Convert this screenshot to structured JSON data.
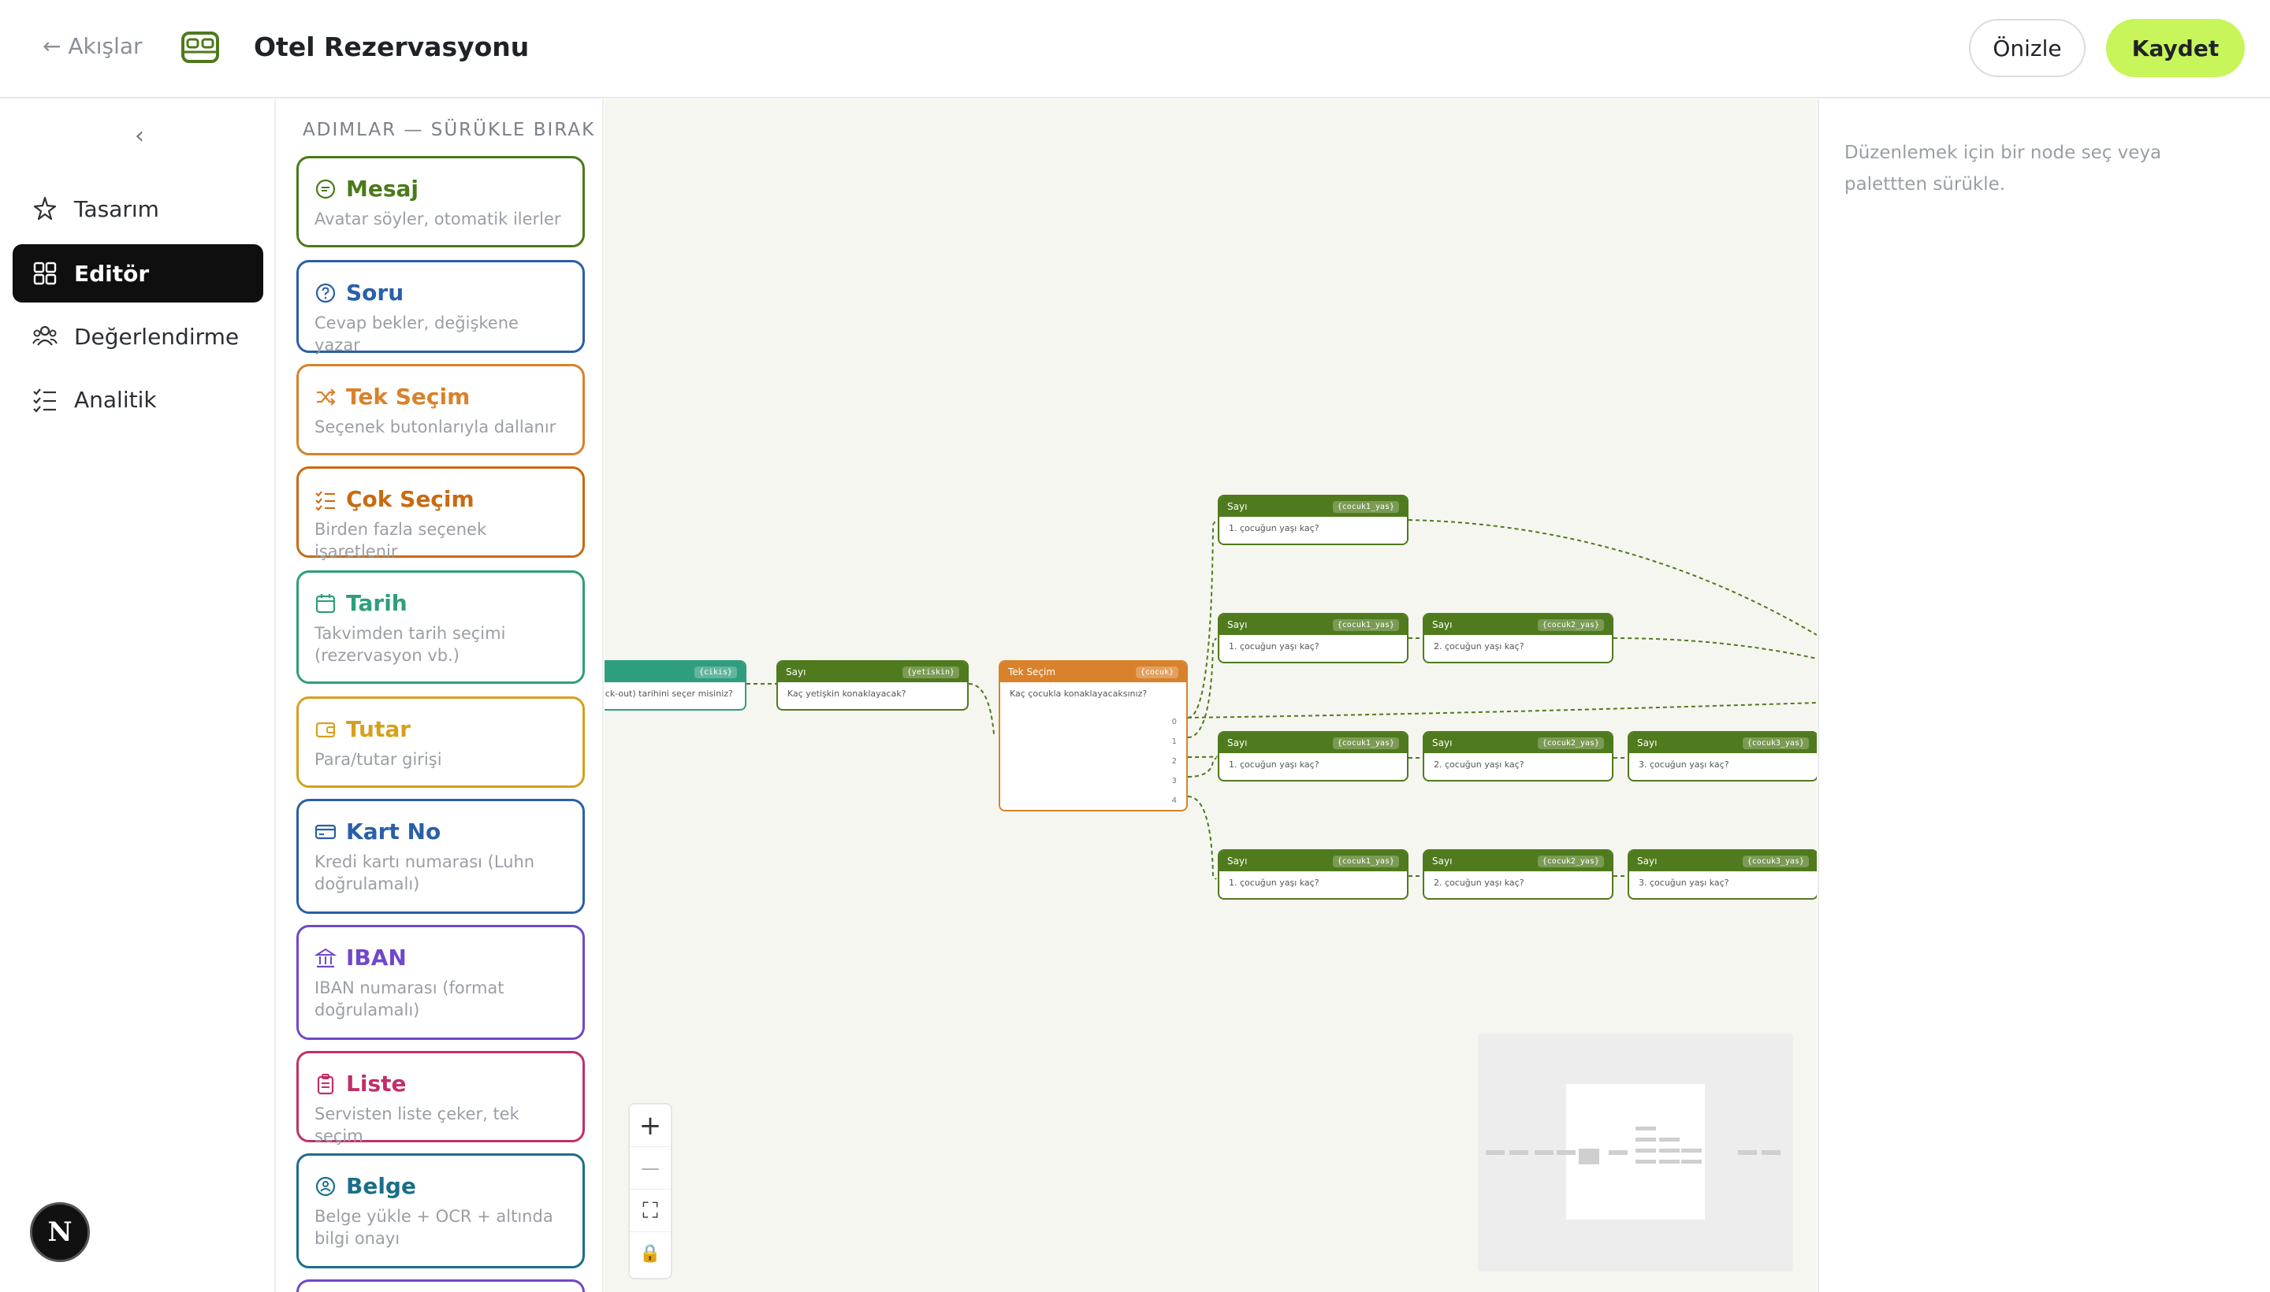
{
  "header": {
    "back_label": "← Akışlar",
    "title": "Otel Rezervasyonu",
    "preview_label": "Önizle",
    "save_label": "Kaydet"
  },
  "sidebar": {
    "items": [
      {
        "label": "Tasarım",
        "icon": "sparkle-icon",
        "active": false
      },
      {
        "label": "Editör",
        "icon": "grid-icon",
        "active": true
      },
      {
        "label": "Değerlendirme",
        "icon": "users-icon",
        "active": false
      },
      {
        "label": "Analitik",
        "icon": "list-check-icon",
        "active": false
      }
    ],
    "badge": "N"
  },
  "palette": {
    "title": "ADIMLAR — SÜRÜKLE BIRAK",
    "steps": [
      {
        "name": "Mesaj",
        "desc": "Avatar söyler, otomatik ilerler",
        "color": "#4a7a1a",
        "icon": "message-icon"
      },
      {
        "name": "Soru",
        "desc": "Cevap bekler, değişkene yazar",
        "color": "#2a5fa8",
        "icon": "question-icon"
      },
      {
        "name": "Tek Seçim",
        "desc": "Seçenek butonlarıyla dallanır",
        "color": "#d9822b",
        "icon": "shuffle-icon"
      },
      {
        "name": "Çok Seçim",
        "desc": "Birden fazla seçenek işaretlenir",
        "color": "#c96a10",
        "icon": "checklist-icon"
      },
      {
        "name": "Tarih",
        "desc": "Takvimden tarih seçimi (rezervasyon vb.)",
        "color": "#2e9e7e",
        "icon": "calendar-icon"
      },
      {
        "name": "Tutar",
        "desc": "Para/tutar girişi",
        "color": "#d6a01e",
        "icon": "wallet-icon"
      },
      {
        "name": "Kart No",
        "desc": "Kredi kartı numarası (Luhn doğrulamalı)",
        "color": "#2a5fa8",
        "icon": "card-icon"
      },
      {
        "name": "IBAN",
        "desc": "IBAN numarası (format doğrulamalı)",
        "color": "#7048c8",
        "icon": "bank-icon"
      },
      {
        "name": "Liste",
        "desc": "Servisten liste çeker, tek seçim",
        "color": "#c0306a",
        "icon": "clipboard-icon"
      },
      {
        "name": "Belge",
        "desc": "Belge yükle + OCR + altında bilgi onayı",
        "color": "#1a6f8a",
        "icon": "document-icon"
      }
    ]
  },
  "canvas": {
    "nodes": {
      "date_node": {
        "type": "",
        "var": "{cikis}",
        "text": "eck-out) tarihini seçer misiniz?"
      },
      "adult_node": {
        "type": "Sayı",
        "var": "{yetiskin}",
        "text": "Kaç yetişkin konaklayacak?"
      },
      "choice_node": {
        "type": "Tek Seçim",
        "var": "{cocuk}",
        "text": "Kaç çocukla konaklayacaksınız?",
        "options": [
          "0",
          "1",
          "2",
          "3",
          "4"
        ]
      },
      "r1c1": {
        "type": "Sayı",
        "var": "{cocuk1_yas}",
        "text": "1. çocuğun yaşı kaç?"
      },
      "r2c1": {
        "type": "Sayı",
        "var": "{cocuk1_yas}",
        "text": "1. çocuğun yaşı kaç?"
      },
      "r2c2": {
        "type": "Sayı",
        "var": "{cocuk2_yas}",
        "text": "2. çocuğun yaşı kaç?"
      },
      "r3c1": {
        "type": "Sayı",
        "var": "{cocuk1_yas}",
        "text": "1. çocuğun yaşı kaç?"
      },
      "r3c2": {
        "type": "Sayı",
        "var": "{cocuk2_yas}",
        "text": "2. çocuğun yaşı kaç?"
      },
      "r3c3": {
        "type": "Sayı",
        "var": "{cocuk3_yas}",
        "text": "3. çocuğun yaşı kaç?"
      },
      "r4c1": {
        "type": "Sayı",
        "var": "{cocuk1_yas}",
        "text": "1. çocuğun yaşı kaç?"
      },
      "r4c2": {
        "type": "Sayı",
        "var": "{cocuk2_yas}",
        "text": "2. çocuğun yaşı kaç?"
      },
      "r4c3": {
        "type": "Sayı",
        "var": "{cocuk3_yas}",
        "text": "3. çocuğun yaşı kaç?"
      }
    },
    "colors": {
      "sayi": "#4f7a1d",
      "choice": "#d9822b",
      "date": "#2e9e7e",
      "wire": "#4f7a1d"
    }
  },
  "controls": {
    "zoom_in": "+",
    "zoom_out": "—",
    "fit": "⛶",
    "lock": "🔒"
  },
  "inspector": {
    "placeholder": "Düzenlemek için bir node seç veya palettten sürükle."
  }
}
